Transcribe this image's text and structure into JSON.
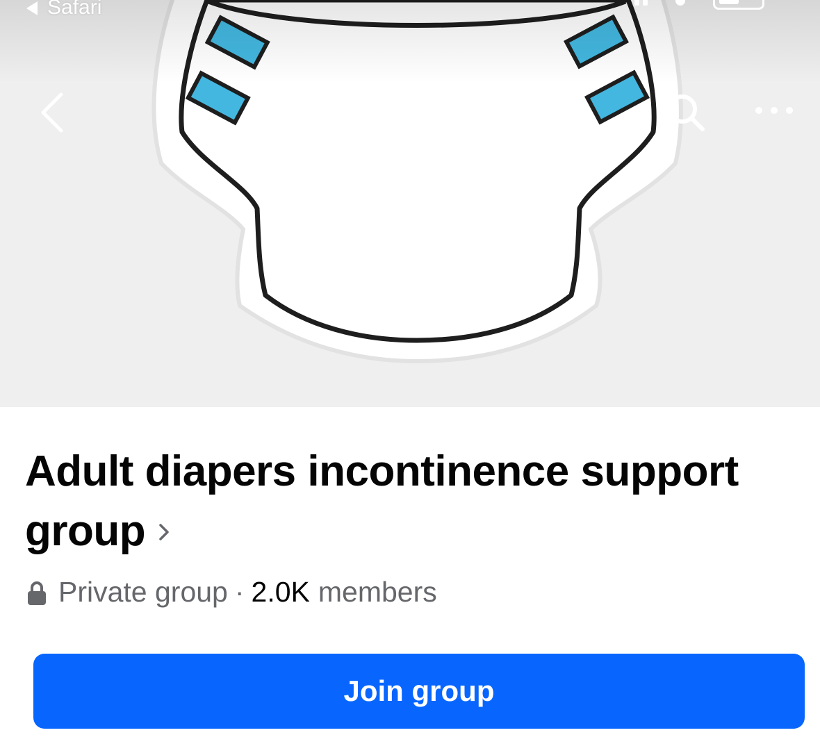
{
  "status_bar": {
    "back_app_label": "Safari"
  },
  "nav": {
    "back_icon": "chevron-left-icon",
    "search_icon": "search-icon",
    "more_icon": "more-dots-icon"
  },
  "cover": {
    "image": "diaper-illustration",
    "tab_color": "#43b7e0",
    "outline_color": "#1e1e1e",
    "background_color": "#efefef"
  },
  "group": {
    "title": "Adult diapers incontinence support group",
    "privacy_label": "Private group",
    "separator": "·",
    "member_count": "2.0K",
    "member_suffix": "members",
    "lock_icon": "lock-icon",
    "chevron_icon": "chevron-right-icon"
  },
  "actions": {
    "join_label": "Join group",
    "join_color": "#0866ff"
  }
}
